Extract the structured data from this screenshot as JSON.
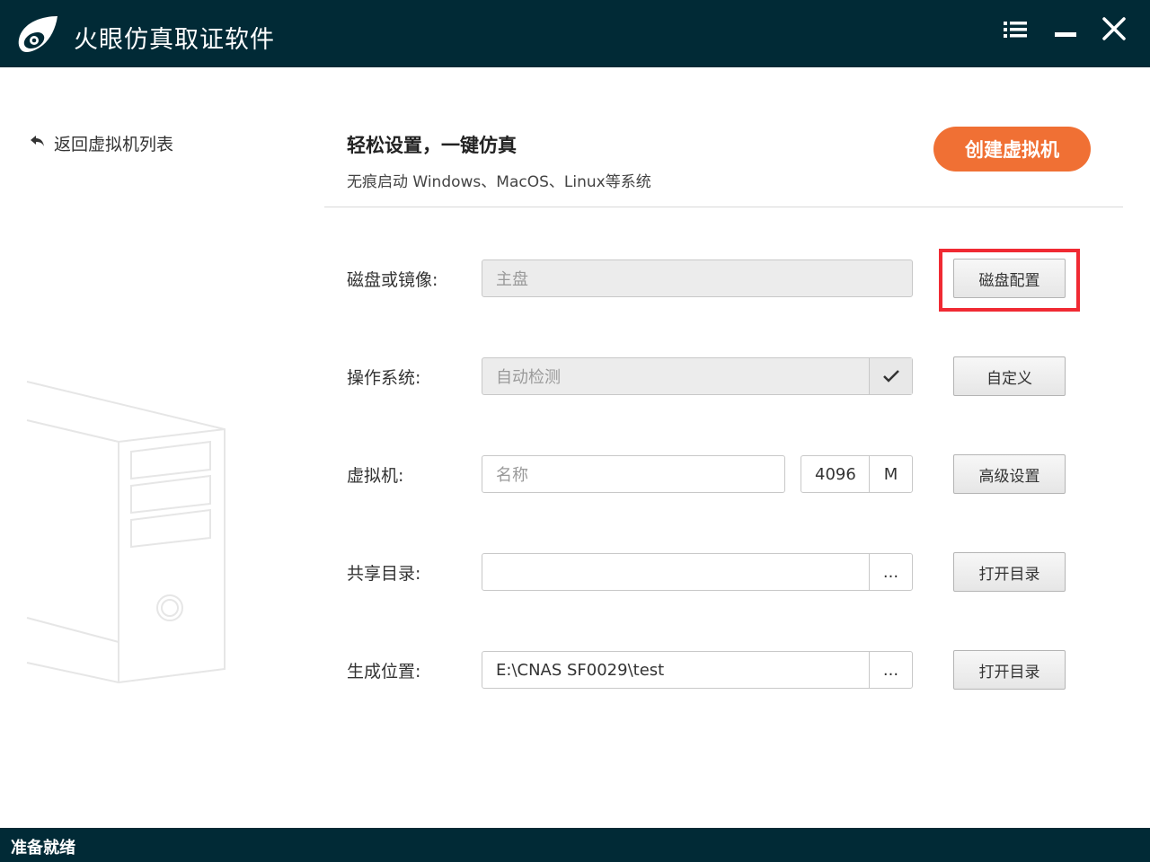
{
  "app": {
    "title": "火眼仿真取证软件",
    "logo_icon": "eye-flame-logo",
    "colors": {
      "titlebar": "#012a36",
      "accent": "#f07034",
      "highlight": "#f02a33"
    }
  },
  "window_controls": {
    "menu_icon": "list-menu-icon",
    "minimize_icon": "minimize-icon",
    "close_icon": "close-icon"
  },
  "nav": {
    "back_label": "返回虚拟机列表",
    "back_icon": "back-arrow-icon"
  },
  "header": {
    "title": "轻松设置，一键仿真",
    "subtitle": "无痕启动 Windows、MacOS、Linux等系统",
    "create_button": "创建虚拟机"
  },
  "form": {
    "disk": {
      "label": "磁盘或镜像:",
      "value": "主盘",
      "button": "磁盘配置"
    },
    "os": {
      "label": "操作系统:",
      "value": "自动检测",
      "button": "自定义",
      "dropdown_icon": "check-icon"
    },
    "vm": {
      "label": "虚拟机:",
      "name_placeholder": "名称",
      "memory": "4096",
      "memory_unit": "M",
      "button": "高级设置"
    },
    "share_dir": {
      "label": "共享目录:",
      "value": "",
      "browse": "...",
      "button": "打开目录"
    },
    "output": {
      "label": "生成位置:",
      "value": "E:\\CNAS SF0029\\test",
      "browse": "...",
      "button": "打开目录"
    }
  },
  "status": {
    "text": "准备就绪"
  }
}
